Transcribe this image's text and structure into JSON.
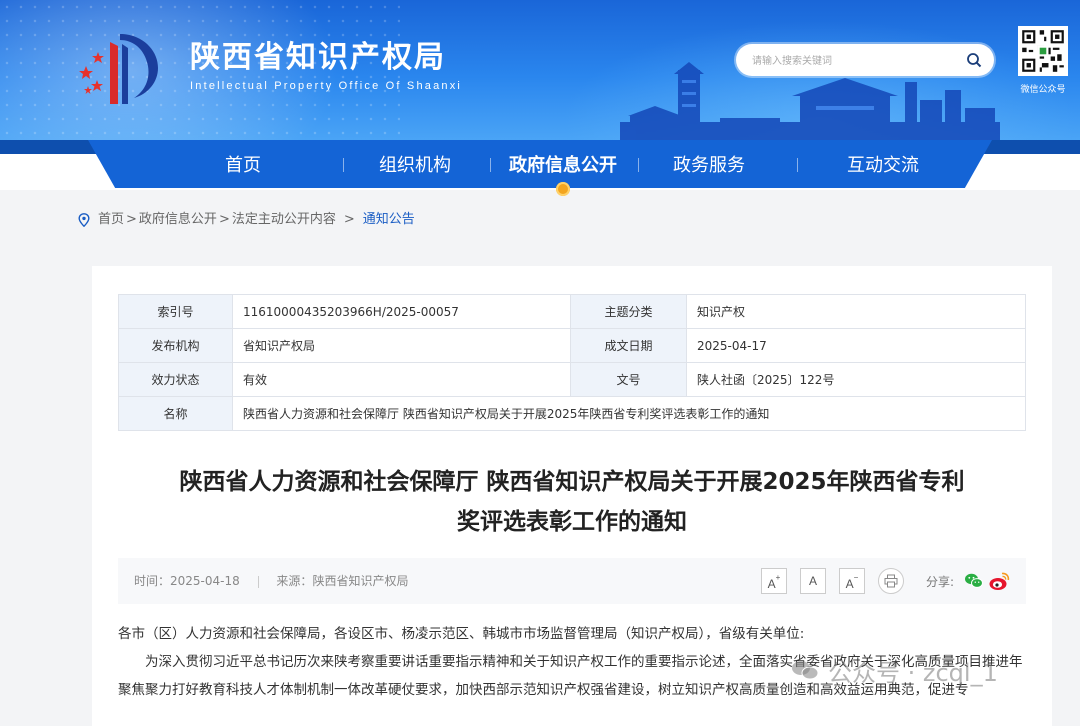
{
  "header": {
    "site_title": "陕西省知识产权局",
    "site_subtitle": "Intellectual Property Office Of Shaanxi",
    "search_placeholder": "请输入搜索关键词",
    "qr_label": "微信公众号"
  },
  "nav": {
    "items": [
      {
        "label": "首页"
      },
      {
        "label": "组织机构"
      },
      {
        "label": "政府信息公开"
      },
      {
        "label": "政务服务"
      },
      {
        "label": "互动交流"
      }
    ],
    "active_index": 2
  },
  "breadcrumb": {
    "items": [
      "首页",
      "政府信息公开",
      "法定主动公开内容"
    ],
    "current": "通知公告",
    "sep": ">"
  },
  "meta_table": {
    "index_no_label": "索引号",
    "index_no": "11610000435203966H/2025-00057",
    "topic_label": "主题分类",
    "topic": "知识产权",
    "issuer_label": "发布机构",
    "issuer": "省知识产权局",
    "date_label": "成文日期",
    "date": "2025-04-17",
    "status_label": "效力状态",
    "status": "有效",
    "doc_no_label": "文号",
    "doc_no": "陕人社函〔2025〕122号",
    "name_label": "名称",
    "name": "陕西省人力资源和社会保障厅 陕西省知识产权局关于开展2025年陕西省专利奖评选表彰工作的通知"
  },
  "article": {
    "title_line1": "陕西省人力资源和社会保障厅 陕西省知识产权局关于开展2025年陕西省专利",
    "title_line2": "奖评选表彰工作的通知",
    "time_label": "时间：",
    "time": "2025-04-18",
    "source_label": "来源：",
    "source": "陕西省知识产权局",
    "font_up": "A",
    "font_reset": "A",
    "font_down": "A",
    "share_label": "分享:",
    "para1": "各市（区）人力资源和社会保障局，各设区市、杨凌示范区、韩城市市场监督管理局（知识产权局），省级有关单位:",
    "para2": "为深入贯彻习近平总书记历次来陕考察重要讲话重要指示精神和关于知识产权工作的重要指示论述，全面落实省委省政府关于深化高质量项目推进年聚焦聚力打好教育科技人才体制机制一体改革硬仗要求，加快西部示范知识产权强省建设，树立知识产权高质量创造和高效益运用典范，促进专"
  },
  "watermark": {
    "text": "公众号 · zcql_1"
  },
  "colors": {
    "banner": "#1a66d8",
    "nav": "#1464d6",
    "active_dot": "#f3a51f",
    "link": "#1a5dc4"
  }
}
